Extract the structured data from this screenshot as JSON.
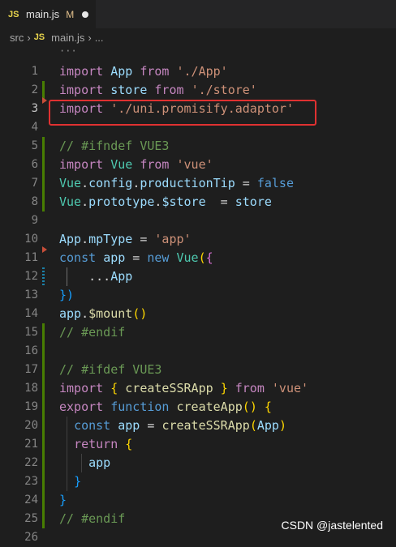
{
  "tab": {
    "type_label": "JS",
    "filename": "main.js",
    "status": "M"
  },
  "breadcrumb": {
    "folder": "src",
    "type_label": "JS",
    "file": "main.js",
    "more": "..."
  },
  "scroll_hint": "···",
  "lines": [
    {
      "num": "1",
      "text": "import App from './App'"
    },
    {
      "num": "2",
      "text": "import store from './store'"
    },
    {
      "num": "3",
      "text": "import './uni.promisify.adaptor'"
    },
    {
      "num": "4",
      "text": ""
    },
    {
      "num": "5",
      "text": "// #ifndef VUE3"
    },
    {
      "num": "6",
      "text": "import Vue from 'vue'"
    },
    {
      "num": "7",
      "text": "Vue.config.productionTip = false"
    },
    {
      "num": "8",
      "text": "Vue.prototype.$store  = store"
    },
    {
      "num": "9",
      "text": ""
    },
    {
      "num": "10",
      "text": "App.mpType = 'app'"
    },
    {
      "num": "11",
      "text": "const app = new Vue({"
    },
    {
      "num": "12",
      "text": "    ...App"
    },
    {
      "num": "13",
      "text": "})"
    },
    {
      "num": "14",
      "text": "app.$mount()"
    },
    {
      "num": "15",
      "text": "// #endif"
    },
    {
      "num": "16",
      "text": ""
    },
    {
      "num": "17",
      "text": "// #ifdef VUE3"
    },
    {
      "num": "18",
      "text": "import { createSSRApp } from 'vue'"
    },
    {
      "num": "19",
      "text": "export function createApp() {"
    },
    {
      "num": "20",
      "text": "  const app = createSSRApp(App)"
    },
    {
      "num": "21",
      "text": "  return {"
    },
    {
      "num": "22",
      "text": "    app"
    },
    {
      "num": "23",
      "text": "  }"
    },
    {
      "num": "24",
      "text": "}"
    },
    {
      "num": "25",
      "text": "// #endif"
    },
    {
      "num": "26",
      "text": ""
    }
  ],
  "active_line": "3",
  "watermark": "CSDN @jastelented",
  "colors": {
    "keyword": "#c586c0",
    "variable": "#9cdcfe",
    "string": "#ce9178",
    "comment": "#6a9955",
    "highlight_box": "#e03131",
    "git_added": "#487e02",
    "git_modified": "#1b81a8",
    "git_deleted": "#c74e39"
  }
}
